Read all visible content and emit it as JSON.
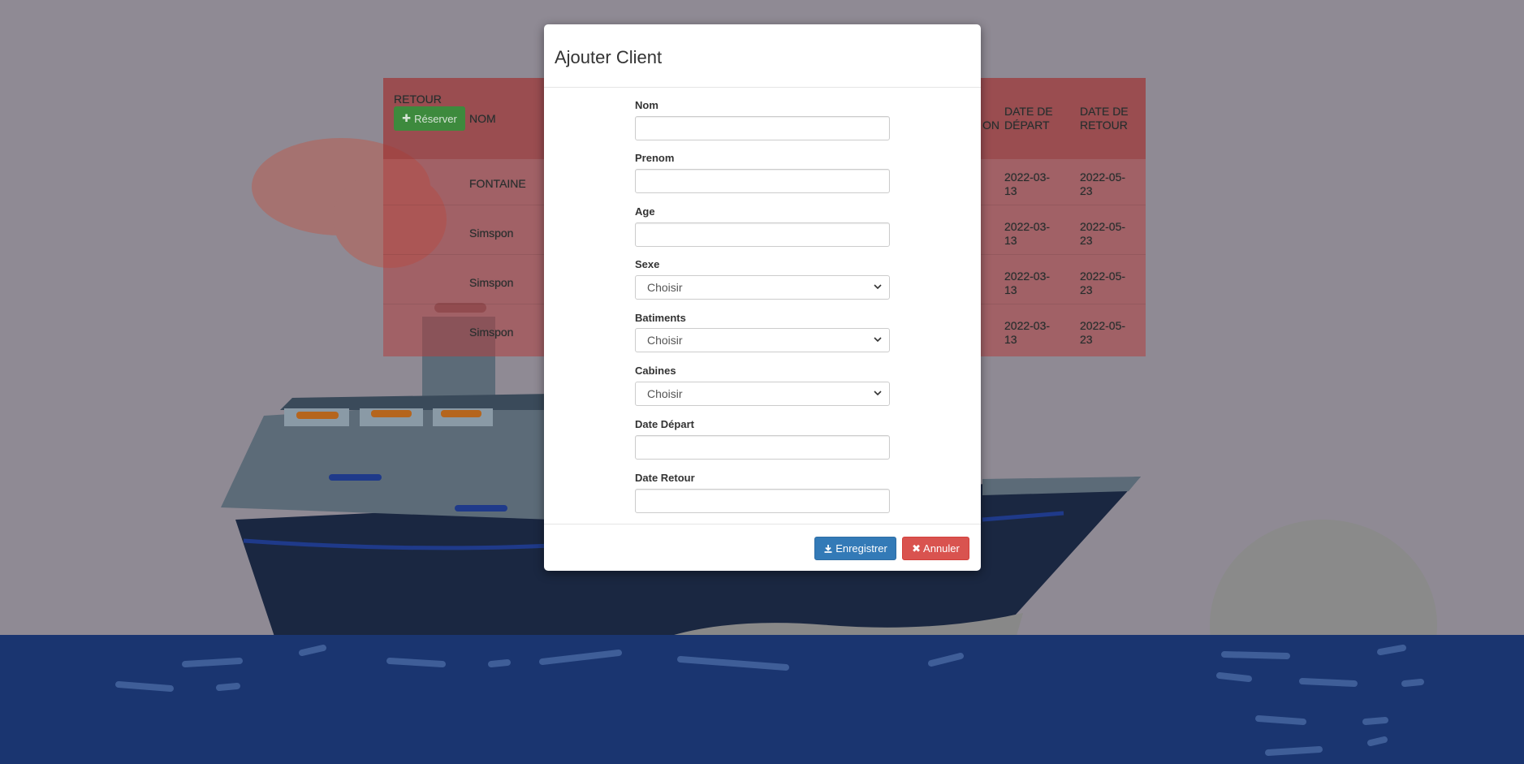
{
  "reservations": {
    "back_label": "RETOUR",
    "reserve_label": "Réserver",
    "headers": {
      "nom": "NOM",
      "partial": "ON",
      "date_depart": "DATE DE DÉPART",
      "date_retour": "DATE DE RETOUR"
    },
    "rows": [
      {
        "nom": "FONTAINE",
        "depart": "2022-03-13",
        "retour": "2022-05-23"
      },
      {
        "nom": "Simspon",
        "depart": "2022-03-13",
        "retour": "2022-05-23"
      },
      {
        "nom": "Simspon",
        "depart": "2022-03-13",
        "retour": "2022-05-23"
      },
      {
        "nom": "Simspon",
        "depart": "2022-03-13",
        "retour": "2022-05-23"
      }
    ]
  },
  "modal": {
    "title": "Ajouter Client",
    "fields": {
      "nom": {
        "label": "Nom",
        "value": ""
      },
      "prenom": {
        "label": "Prenom",
        "value": ""
      },
      "age": {
        "label": "Age",
        "value": ""
      },
      "sexe": {
        "label": "Sexe",
        "selected": "Choisir"
      },
      "batiments": {
        "label": "Batiments",
        "selected": "Choisir"
      },
      "cabines": {
        "label": "Cabines",
        "selected": "Choisir"
      },
      "date_depart": {
        "label": "Date Départ",
        "value": ""
      },
      "date_retour": {
        "label": "Date Retour",
        "value": ""
      }
    },
    "save_label": "Enregistrer",
    "cancel_label": "Annuler"
  },
  "icons": {
    "reserve": "plus-icon",
    "save": "download-icon",
    "cancel": "close-icon"
  },
  "colors": {
    "primary": "#337ab7",
    "danger": "#d9534f",
    "success": "#3d8a3d",
    "sea": "#1a3570"
  }
}
